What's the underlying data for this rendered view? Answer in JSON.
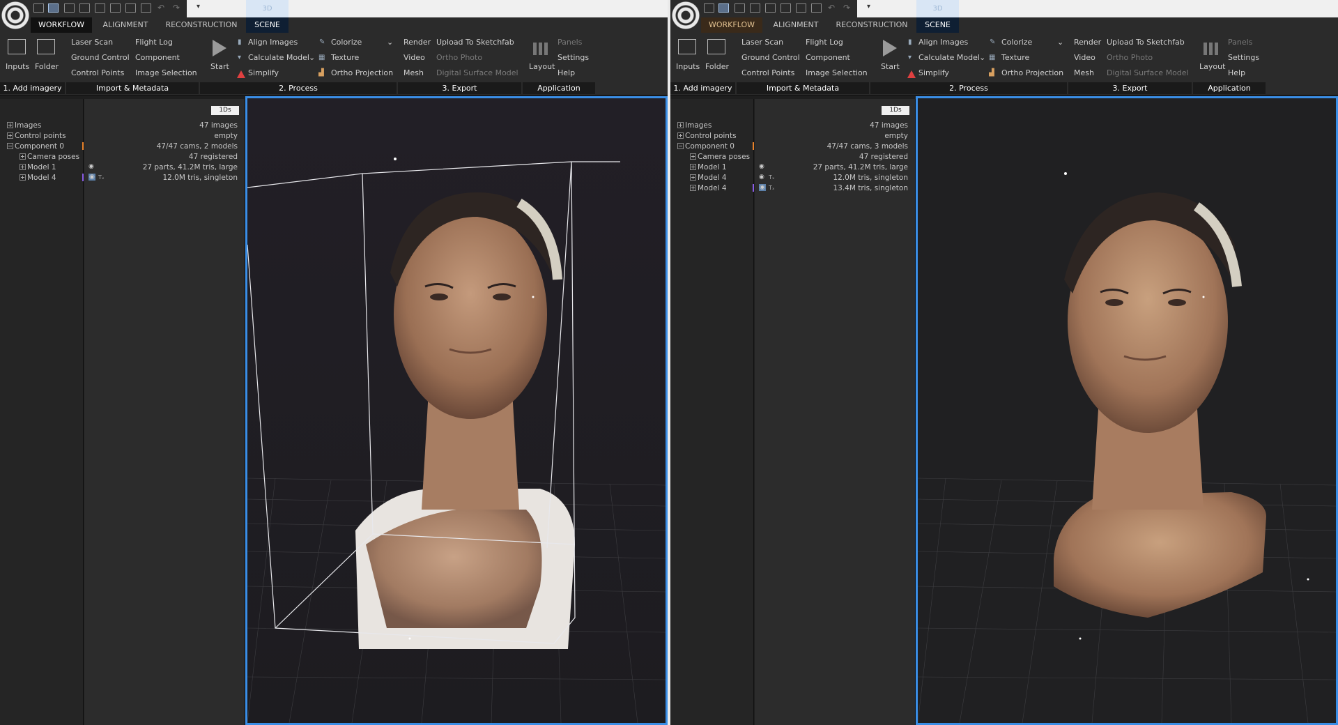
{
  "tabs": {
    "workflow": "WORKFLOW",
    "alignment": "ALIGNMENT",
    "reconstruction": "RECONSTRUCTION",
    "scene": "SCENE",
    "mode3d": "3D"
  },
  "ribbon": {
    "inputs": "Inputs",
    "folder": "Folder",
    "laser_scan": "Laser Scan",
    "ground_control": "Ground Control",
    "control_points": "Control Points",
    "flight_log": "Flight Log",
    "component": "Component",
    "image_selection": "Image Selection",
    "start": "Start",
    "align_images": "Align Images",
    "calculate_model": "Calculate Model",
    "simplify": "Simplify",
    "colorize": "Colorize",
    "texture": "Texture",
    "ortho_projection": "Ortho Projection",
    "render": "Render",
    "video": "Video",
    "mesh": "Mesh",
    "upload_sketchfab": "Upload To Sketchfab",
    "ortho_photo": "Ortho Photo",
    "dsm": "Digital Surface Model",
    "layout": "Layout",
    "panels": "Panels",
    "settings": "Settings",
    "help": "Help",
    "groups": {
      "add_imagery": "1. Add imagery",
      "import_metadata": "Import & Metadata",
      "process": "2. Process",
      "export": "3. Export",
      "application": "Application"
    }
  },
  "badge": "1Ds",
  "left": {
    "tree": [
      "Images",
      "Control points",
      "Component 0",
      "Camera poses",
      "Model 1",
      "Model 4"
    ],
    "values": [
      "47 images",
      "empty",
      "47/47 cams, 2 models",
      "47 registered",
      "27 parts, 41.2M tris, large",
      "12.0M tris, singleton"
    ],
    "tex": "Tₓ"
  },
  "right": {
    "tree": [
      "Images",
      "Control points",
      "Component 0",
      "Camera poses",
      "Model 1",
      "Model 4",
      "Model 4"
    ],
    "values": [
      "47 images",
      "empty",
      "47/47 cams, 3 models",
      "47 registered",
      "27 parts, 41.2M tris, large",
      "12.0M tris, singleton",
      "13.4M tris, singleton"
    ],
    "tex": "Tₓ"
  },
  "colors": {
    "accent": "#3a8ee6",
    "marker_orange": "#e8822a",
    "marker_purple": "#8a5ce6"
  }
}
